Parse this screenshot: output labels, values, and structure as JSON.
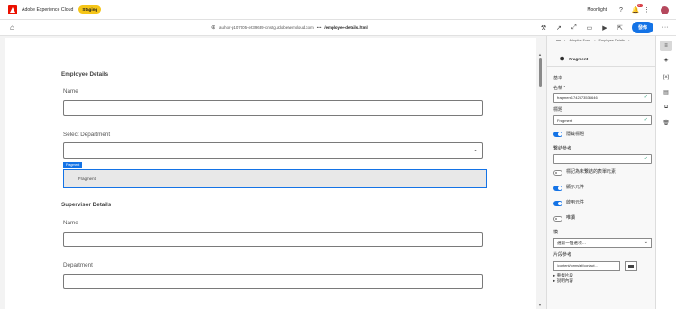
{
  "topbar": {
    "brand": "Adobe Experience Cloud",
    "staging": "Staging",
    "org": "Moonlight",
    "notification_count": "9+"
  },
  "toolbar": {
    "url_host": "author-p107005-e239639-cmstg.adobeaemcloud.com",
    "url_sep": "•••",
    "url_page": "/employee-details.html",
    "publish_label": "發佈"
  },
  "form": {
    "employee_title": "Employee Details",
    "name_label": "Name",
    "department_label": "Select Department",
    "fragment_tag": "Fragment",
    "fragment_text": "Fragment",
    "supervisor_title": "Supervisor Details",
    "sup_name_label": "Name",
    "sup_department_label": "Department"
  },
  "panel": {
    "breadcrumb": [
      "Adaptive Form",
      "Employee Details"
    ],
    "component_title": "Fragment",
    "basic_heading": "基本",
    "name_label": "名稱 *",
    "name_value": "fragment1742373536646",
    "title_label": "標題",
    "title_value": "Fragment",
    "hide_title_label": "隱藏標題",
    "bind_ref_label": "繫結參考",
    "bind_ref_value": "",
    "unbound_label": "標記為未繫結的表單元素",
    "visible_label": "顯示元件",
    "enabled_label": "啟用元件",
    "readonly_label": "唯讀",
    "model_label": "模",
    "model_placeholder": "選取一個選項…",
    "fragment_ref_label": "片段參考",
    "fragment_ref_value": "/content/forms/af/contact...",
    "repeat_link": "重複片段",
    "help_link": "說明內容"
  },
  "icons": {
    "accent": "#1473e6",
    "brand": "#eb1000",
    "staging": "#f5c518",
    "valid": "#2d9d78"
  }
}
